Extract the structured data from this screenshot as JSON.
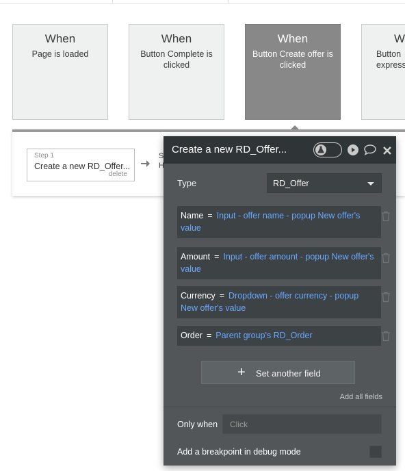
{
  "events": [
    {
      "when": "When",
      "desc": "Page is loaded"
    },
    {
      "when": "When",
      "desc": "Button Complete is clicked"
    },
    {
      "when": "When",
      "desc": "Button Create offer is clicked"
    },
    {
      "when": "W",
      "desc": "Button\nexpress"
    }
  ],
  "step": {
    "number": "Step 1",
    "title": "Create a new RD_Offer...",
    "delete": "delete",
    "next_partial": "S\nH"
  },
  "panel": {
    "title": "Create a new RD_Offer...",
    "type_label": "Type",
    "type_value": "RD_Offer",
    "fields": [
      {
        "name": "Name",
        "eq": "=",
        "expr": "Input - offer name - popup New offer's value"
      },
      {
        "name": "Amount",
        "eq": "=",
        "expr": "Input - offer amount - popup New offer's value"
      },
      {
        "name": "Currency",
        "eq": "=",
        "expr": "Dropdown - offer currency - popup New offer's value"
      },
      {
        "name": "Order",
        "eq": "=",
        "expr": "Parent group's RD_Order"
      }
    ],
    "set_another": "Set another field",
    "add_all": "Add all fields",
    "only_when_label": "Only when",
    "only_when_placeholder": "Click",
    "breakpoint_label": "Add a breakpoint in debug mode"
  },
  "colors": {
    "expression": "#6aa8ff",
    "panel_bg": "#525658",
    "header_bg": "#2f3436",
    "selected_event": "#888888"
  },
  "icons": [
    "debug-toggle-icon",
    "play-icon",
    "comment-icon",
    "close-icon",
    "trash-icon",
    "plus-icon",
    "arrow-right-icon"
  ]
}
